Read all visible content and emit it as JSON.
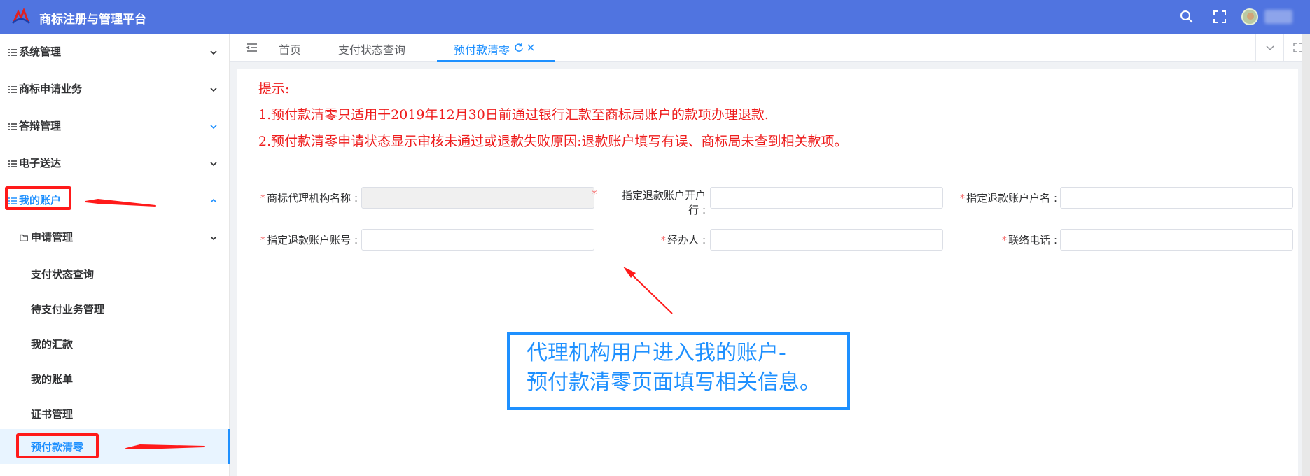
{
  "app": {
    "title": "商标注册与管理平台",
    "header_color": "#5074e0"
  },
  "header_icons": [
    "search-icon",
    "fullscreen-icon",
    "avatar"
  ],
  "sidebar": {
    "items": [
      {
        "label": "系统管理",
        "expanded": false
      },
      {
        "label": "商标申请业务",
        "expanded": false
      },
      {
        "label": "答辩管理",
        "expanded": false
      },
      {
        "label": "电子送达",
        "expanded": false
      },
      {
        "label": "我的账户",
        "expanded": true
      }
    ],
    "group": {
      "label": "申请管理"
    },
    "sub_items": [
      {
        "label": "支付状态查询"
      },
      {
        "label": "待支付业务管理"
      },
      {
        "label": "我的汇款"
      },
      {
        "label": "我的账单"
      },
      {
        "label": "证书管理"
      },
      {
        "label": "预付款清零"
      }
    ]
  },
  "tabs": [
    {
      "label": "首页",
      "active": false
    },
    {
      "label": "支付状态查询",
      "active": false
    },
    {
      "label": "预付款清零",
      "active": true
    }
  ],
  "notice": {
    "title": "提示:",
    "lines": [
      "1.预付款清零只适用于2019年12月30日前通过银行汇款至商标局账户的款项办理退款.",
      "2.预付款清零申请状态显示审核未通过或退款失败原因:退款账户填写有误、商标局未查到相关款项。"
    ],
    "color": "#ee1c1c"
  },
  "form": {
    "agency_name_label": "商标代理机构名称 :",
    "bank_label_line1": "指定退款账户开户",
    "bank_label_line2": "行 :",
    "account_name_label": "指定退款账户户名 :",
    "account_no_label": "指定退款账户账号 :",
    "handler_label": "经办人 :",
    "phone_label": "联络电话 :",
    "required_mark": "*"
  },
  "annotation": {
    "callout_line1": "代理机构用户进入我的账户-",
    "callout_line2": "预付款清零页面填写相关信息。",
    "callout_color": "#1e90ff",
    "highlight_color": "#ff1a1a"
  }
}
